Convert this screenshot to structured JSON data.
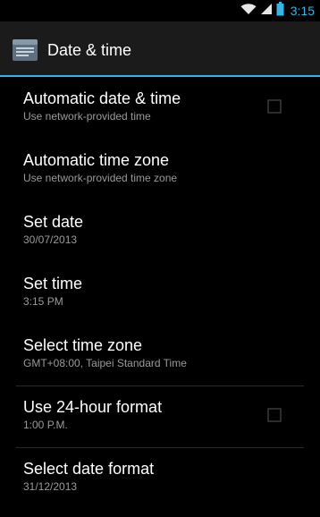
{
  "status_bar": {
    "time": "3:15",
    "icons": [
      "wifi-icon",
      "signal-icon",
      "battery-icon"
    ],
    "accent_color": "#33b5e5"
  },
  "action_bar": {
    "title": "Date & time",
    "icon": "settings-app-icon"
  },
  "settings": [
    {
      "title": "Automatic date & time",
      "summary": "Use network-provided time",
      "control": "checkbox",
      "checked": false
    },
    {
      "title": "Automatic time zone",
      "summary": "Use network-provided time zone"
    },
    {
      "title": "Set date",
      "summary": "30/07/2013"
    },
    {
      "title": "Set time",
      "summary": "3:15 PM"
    },
    {
      "title": "Select time zone",
      "summary": "GMT+08:00, Taipei Standard Time"
    },
    {
      "title": "Use 24-hour format",
      "summary": "1:00 P.M.",
      "control": "checkbox",
      "checked": false
    },
    {
      "title": "Select date format",
      "summary": "31/12/2013"
    }
  ],
  "colors": {
    "background": "#000000",
    "action_bar": "#1b1b1b",
    "accent": "#33b5e5",
    "summary_text": "#9a9a9a"
  }
}
